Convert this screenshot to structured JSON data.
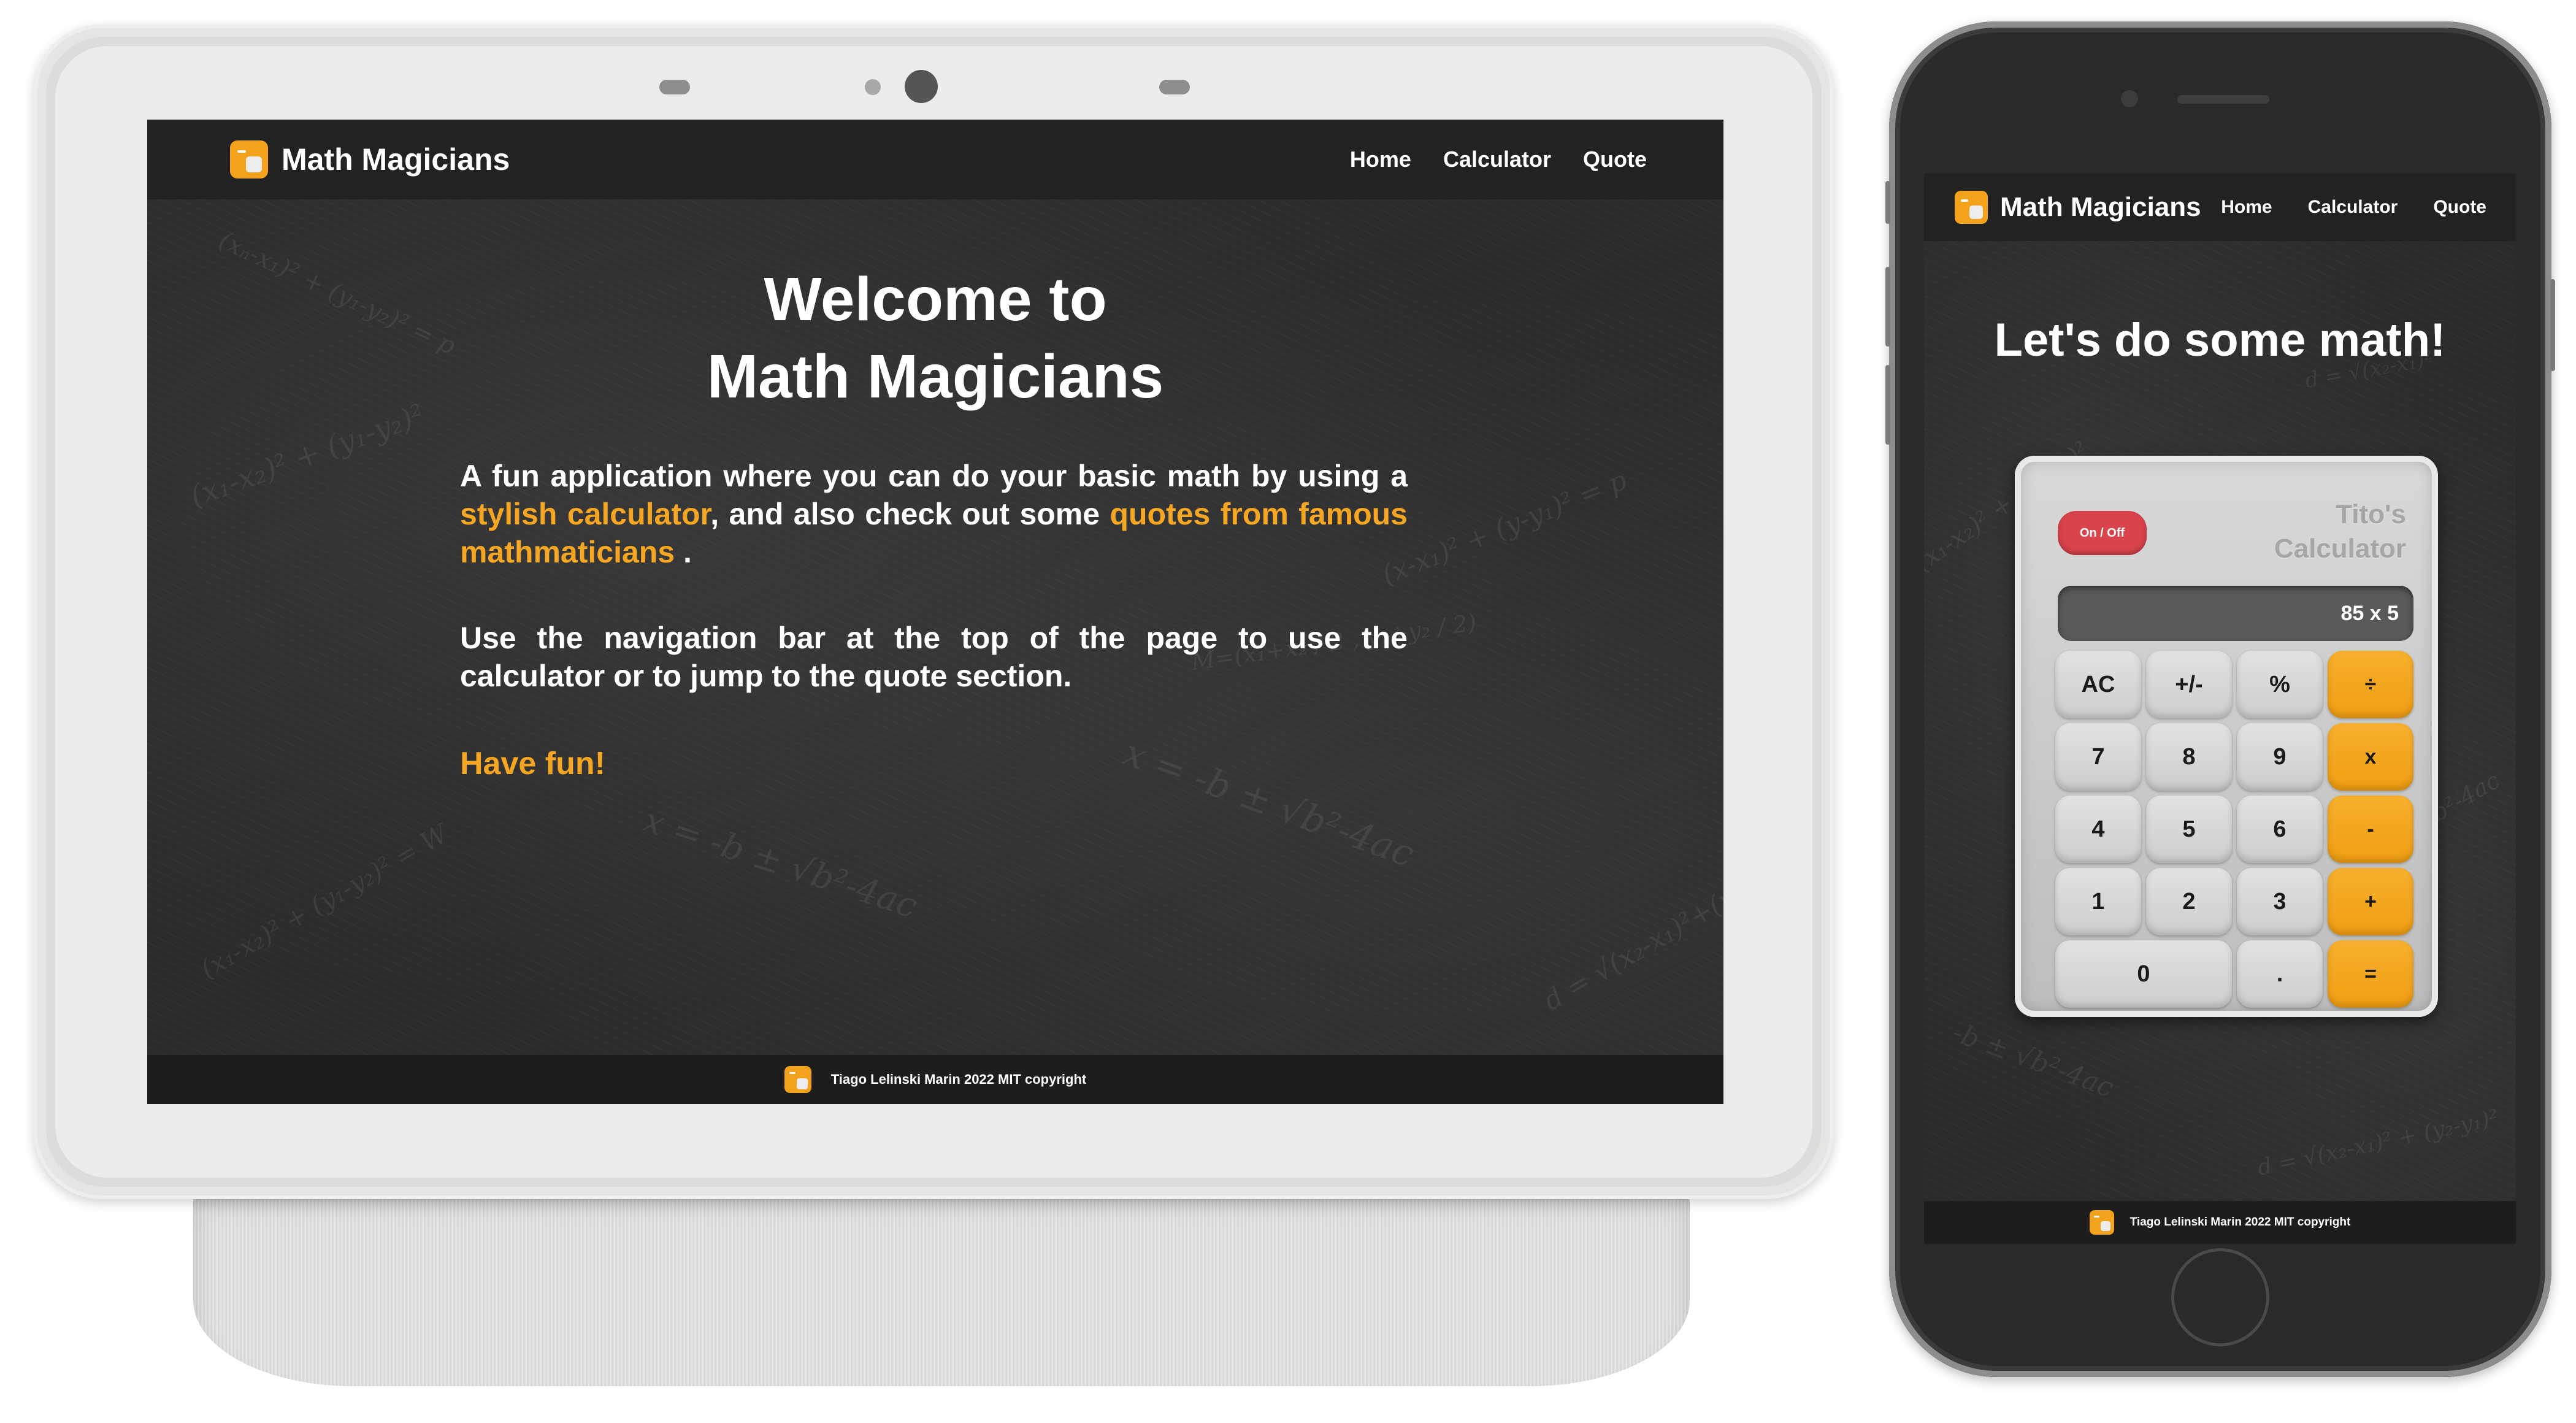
{
  "app": {
    "brand": "Math Magicians",
    "accent_color": "#f5a623",
    "logo_icon": "calculator-icon"
  },
  "nav": {
    "items": [
      "Home",
      "Calculator",
      "Quote"
    ]
  },
  "home": {
    "title_line1": "Welcome to",
    "title_line2": "Math Magicians",
    "para1_start": "A fun application where you can do your basic math by using a ",
    "para1_link1": "stylish calculator",
    "para1_mid": ", and also check out some ",
    "para1_link2": "quotes from famous mathmaticians",
    "para1_end": " .",
    "para2": "Use the navigation bar at the top of the page to use the calculator or to jump to the quote section.",
    "have_fun": "Have fun!"
  },
  "calculator_page": {
    "heading": "Let's do some math!",
    "power_button": "On / Off",
    "calc_name_line1": "Tito's",
    "calc_name_line2": "Calculator",
    "display": "85 x 5",
    "keys": [
      {
        "label": "AC",
        "type": "fn"
      },
      {
        "label": "+/-",
        "type": "fn"
      },
      {
        "label": "%",
        "type": "fn"
      },
      {
        "label": "÷",
        "type": "op"
      },
      {
        "label": "7",
        "type": "num"
      },
      {
        "label": "8",
        "type": "num"
      },
      {
        "label": "9",
        "type": "num"
      },
      {
        "label": "x",
        "type": "op"
      },
      {
        "label": "4",
        "type": "num"
      },
      {
        "label": "5",
        "type": "num"
      },
      {
        "label": "6",
        "type": "num"
      },
      {
        "label": "-",
        "type": "op"
      },
      {
        "label": "1",
        "type": "num"
      },
      {
        "label": "2",
        "type": "num"
      },
      {
        "label": "3",
        "type": "num"
      },
      {
        "label": "+",
        "type": "op"
      },
      {
        "label": "0",
        "type": "zero"
      },
      {
        "label": ".",
        "type": "num"
      },
      {
        "label": "=",
        "type": "op"
      }
    ]
  },
  "footer": {
    "text": "Tiago Lelinski Marin 2022 MIT copyright"
  }
}
